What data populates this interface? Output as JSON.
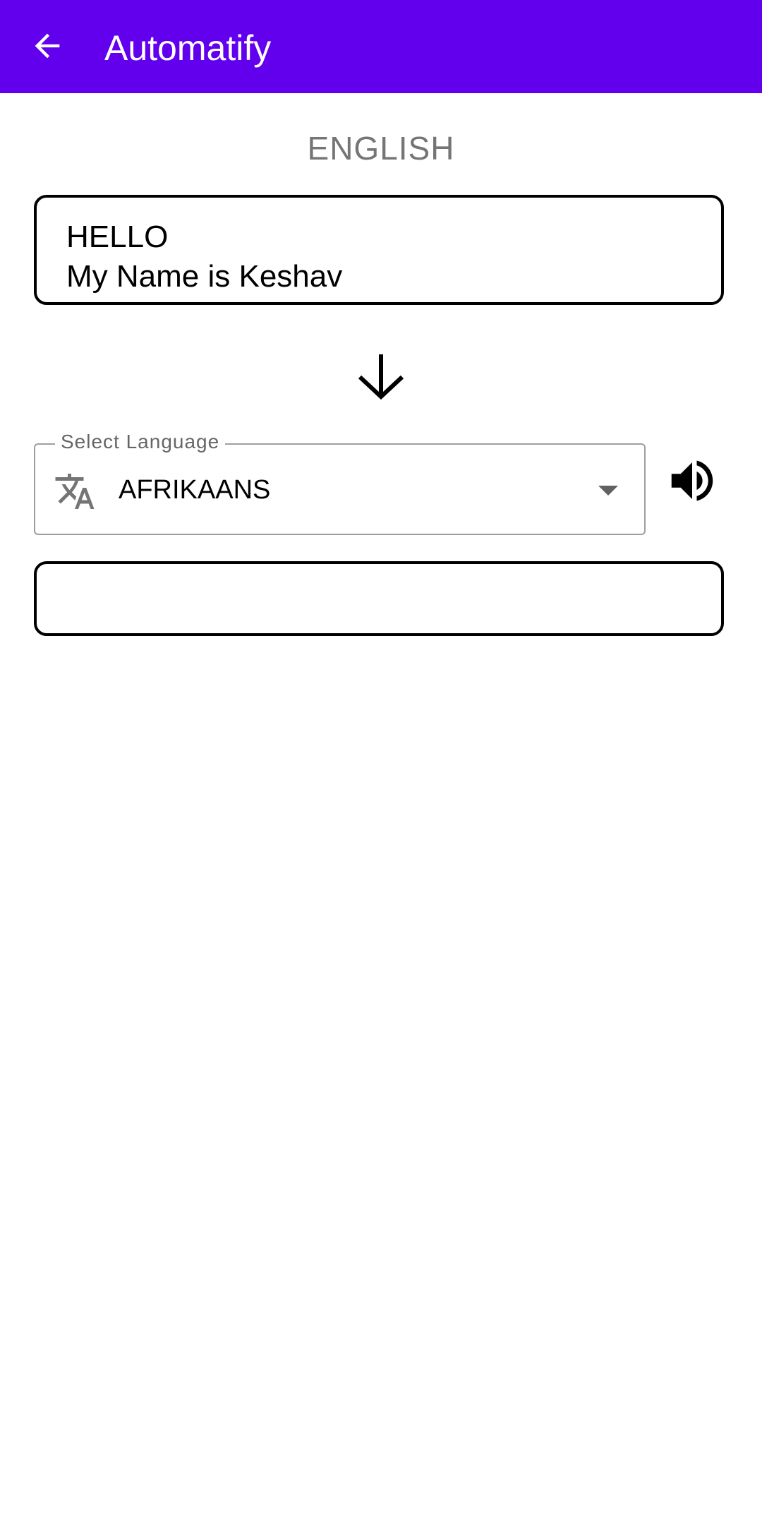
{
  "app_bar": {
    "title": "Automatify",
    "background": "#6200EE",
    "back_icon": "arrow-back-icon"
  },
  "source": {
    "language": "ENGLISH",
    "text_lines": [
      "HELLO",
      "My Name is Keshav"
    ]
  },
  "direction_icon": "arrow-down-icon",
  "target": {
    "select_label": "Select Language",
    "selected_language": "AFRIKAANS",
    "leading_icon": "translate-icon",
    "trailing_icon": "dropdown-caret-icon",
    "speaker_icon": "volume-up-icon",
    "output_text": ""
  }
}
